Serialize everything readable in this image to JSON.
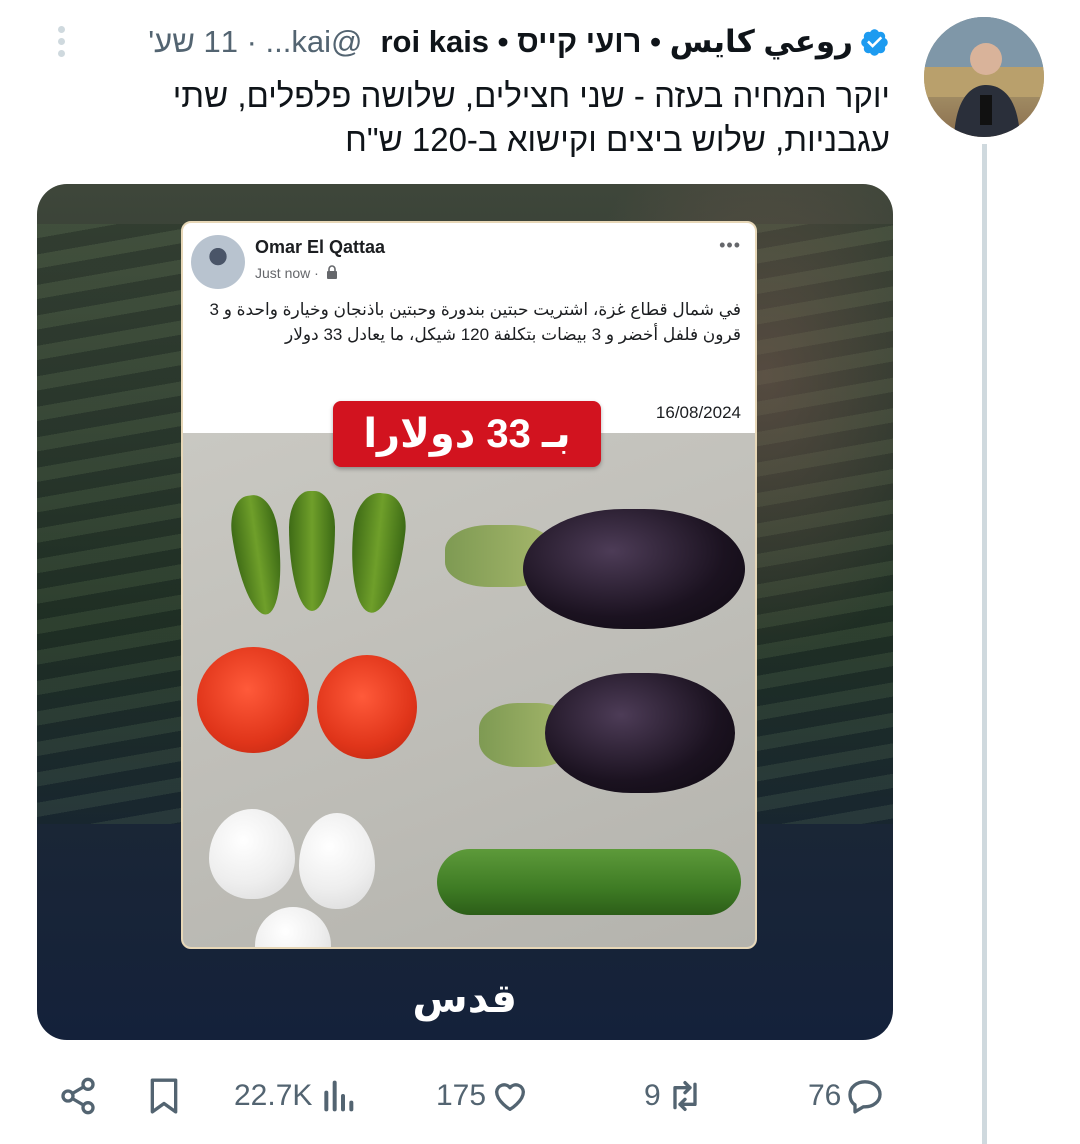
{
  "tweet": {
    "display_name_ar": "روعي كايس",
    "display_name_he": "רועי קייס",
    "display_name_en": "roi kais",
    "handle": "@kai...",
    "time": "11 שע'",
    "text_line1": "יוקר המחיה בעזה - שני חצילים, שלושה פלפלים, שתי",
    "text_line2": "עגבניות, שלוש ביצים וקישוא ב-120 ש\"ח"
  },
  "embedded_post": {
    "author": "Omar El Qattaa",
    "time": "Just now ·",
    "text": "في شمال قطاع غزة، اشتريت حبتين بندورة وحبتين باذنجان وخيارة واحدة و 3 قرون فلفل أخضر و 3 بيضات بتكلفة 120 شيكل، ما يعادل 33 دولار",
    "date": "16/08/2024",
    "price_badge": "بـ 33 دولارا"
  },
  "watermark": "قدس",
  "actions": {
    "views": "22.7K",
    "likes": "175",
    "retweets": "9",
    "replies": "76"
  },
  "colors": {
    "verified": "#1d9bf0",
    "badge_red": "#d2131f",
    "muted_text": "#536471"
  }
}
